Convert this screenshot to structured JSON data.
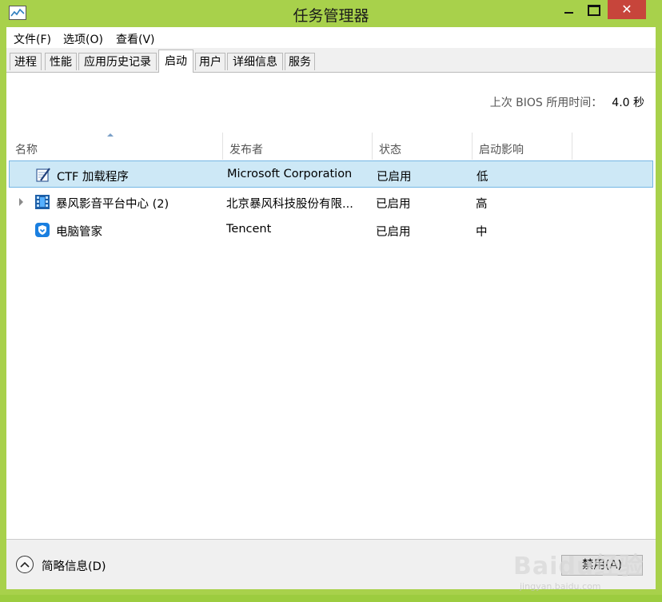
{
  "window": {
    "title": "任务管理器"
  },
  "menu": {
    "items": [
      {
        "label": "文件(F)"
      },
      {
        "label": "选项(O)"
      },
      {
        "label": "查看(V)"
      }
    ]
  },
  "tabs": [
    {
      "label": "进程"
    },
    {
      "label": "性能"
    },
    {
      "label": "应用历史记录"
    },
    {
      "label": "启动",
      "active": true
    },
    {
      "label": "用户"
    },
    {
      "label": "详细信息"
    },
    {
      "label": "服务"
    }
  ],
  "bios": {
    "label": "上次 BIOS 所用时间：",
    "value": "4.0 秒"
  },
  "table": {
    "columns": [
      {
        "label": "名称"
      },
      {
        "label": "发布者"
      },
      {
        "label": "状态"
      },
      {
        "label": "启动影响"
      }
    ],
    "rows": [
      {
        "name": "CTF 加载程序",
        "publisher": "Microsoft Corporation",
        "status": "已启用",
        "impact": "低",
        "icon": "ctf-loader-icon",
        "selected": true
      },
      {
        "name": "暴风影音平台中心 (2)",
        "publisher": "北京暴风科技股份有限...",
        "status": "已启用",
        "impact": "高",
        "icon": "baofeng-icon",
        "expandable": true
      },
      {
        "name": "电脑管家",
        "publisher": "Tencent",
        "status": "已启用",
        "impact": "中",
        "icon": "pc-manager-shield-icon"
      }
    ]
  },
  "footer": {
    "brief_label": "简略信息(D)",
    "disable_label": "禁用(A)"
  },
  "watermark": {
    "text": "Baidu经验",
    "sub": "jingyan.baidu.com"
  },
  "colors": {
    "frame": "#a8d14b",
    "close": "#c7453b",
    "selected_row": "#cde8f6",
    "selected_border": "#73b6e4"
  }
}
